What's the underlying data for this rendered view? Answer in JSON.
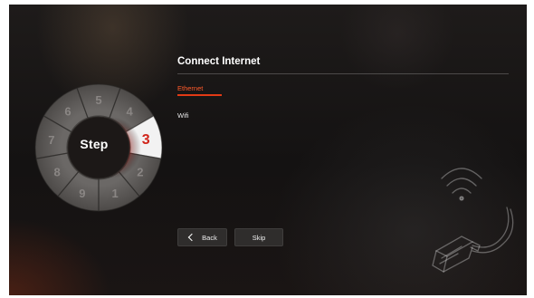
{
  "setup": {
    "current_step": "3",
    "wheel_label": "Step",
    "steps": [
      "5",
      "4",
      "3",
      "2",
      "1",
      "9",
      "8",
      "7",
      "6"
    ]
  },
  "content": {
    "title": "Connect Internet",
    "options": [
      {
        "label": "Ethernet",
        "selected": true
      },
      {
        "label": "Wifi",
        "selected": false
      }
    ]
  },
  "buttons": {
    "back_label": "Back",
    "skip_label": "Skip"
  },
  "colors": {
    "accent": "#e23a15",
    "accent_text": "#ff5a2a",
    "current_step_number": "#d0251a"
  },
  "icons": {
    "back": "back-arrow-icon",
    "illustration": "wifi-ethernet-illustration-icon"
  }
}
